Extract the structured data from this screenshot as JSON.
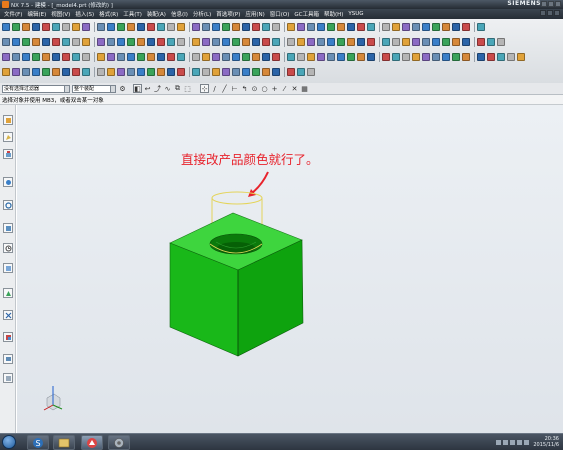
{
  "window": {
    "title": "NX 7.5 - 建模 - [_model4.prt (修改的) ]",
    "brand": "SIEMENS"
  },
  "menu": {
    "items": [
      "文件(F)",
      "编辑(E)",
      "视图(V)",
      "插入(S)",
      "格式(R)",
      "工具(T)",
      "装配(A)",
      "信息(I)",
      "分析(L)",
      "首选项(P)",
      "应用(N)",
      "窗口(O)",
      "GC工具箱",
      "帮助(H)",
      "YSUG"
    ]
  },
  "selection": {
    "filter_value": "没有选择过滤器",
    "assembly_scope_value": "整个装配"
  },
  "cue": {
    "text": "选择对象并使用 MB3，或者双击某一对象"
  },
  "viewport": {
    "annotation": "直接改产品颜色就行了。",
    "model_color": "#1fc21f",
    "annotation_color": "#e8232c"
  },
  "taskbar": {
    "apps": [
      "s-app-icon",
      "window-app-icon",
      "nx-app-icon",
      "settings-app-icon"
    ],
    "time": "20:36",
    "date": "2015/11/6"
  }
}
